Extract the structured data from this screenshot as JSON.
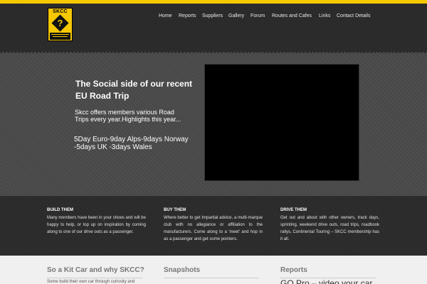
{
  "colors": {
    "accent": "#f5c800",
    "header_bg": "#2a2a2a",
    "hero_bg": "#4a4a4a",
    "lower_bg": "#f0f0f0"
  },
  "logo": {
    "text": "SKCC",
    "icon": "diamond-question-icon"
  },
  "nav": {
    "items": [
      {
        "label": "Home"
      },
      {
        "label": "Reports"
      },
      {
        "label": "Suppliers"
      },
      {
        "label": "Gallery"
      },
      {
        "label": "Forum"
      },
      {
        "label": "Routes and Cafes"
      },
      {
        "label": "Links"
      },
      {
        "label": "Contact Details"
      }
    ]
  },
  "hero": {
    "title": "The Social side of our recent EU Road Trip",
    "description": "Skcc offers members various Road Trips every year.Highlights this year...",
    "trips": "5Day Euro-9day Alps-9days Norway -5days UK -3days Wales"
  },
  "features": [
    {
      "heading": "BUILD THEM",
      "text": "Many members have been in your shoes and will be happy to help, or top up on inspiration by coming along to one of our drive outs as a passenger."
    },
    {
      "heading": "BUY THEM",
      "text": "Where better to get Impartial advice, a multi-marque club with no allegiance or affiliation to the manufacturers. Come along to a 'meet' and hop in as a passenger and get some pointers."
    },
    {
      "heading": "DRIVE THEM",
      "text": "Get out and about with other owners, track days, sprinting, weekend drive outs, road trips, roadbook rallys, Continental Touring – SKCC membership has it all."
    }
  ],
  "lower": {
    "col1": {
      "heading": "So a Kit Car and why SKCC?",
      "text": "Some build their own car through curiosity and"
    },
    "col2": {
      "heading": "Snapshots"
    },
    "col3": {
      "heading": "Reports",
      "link": "GO Pro – video your car"
    }
  }
}
